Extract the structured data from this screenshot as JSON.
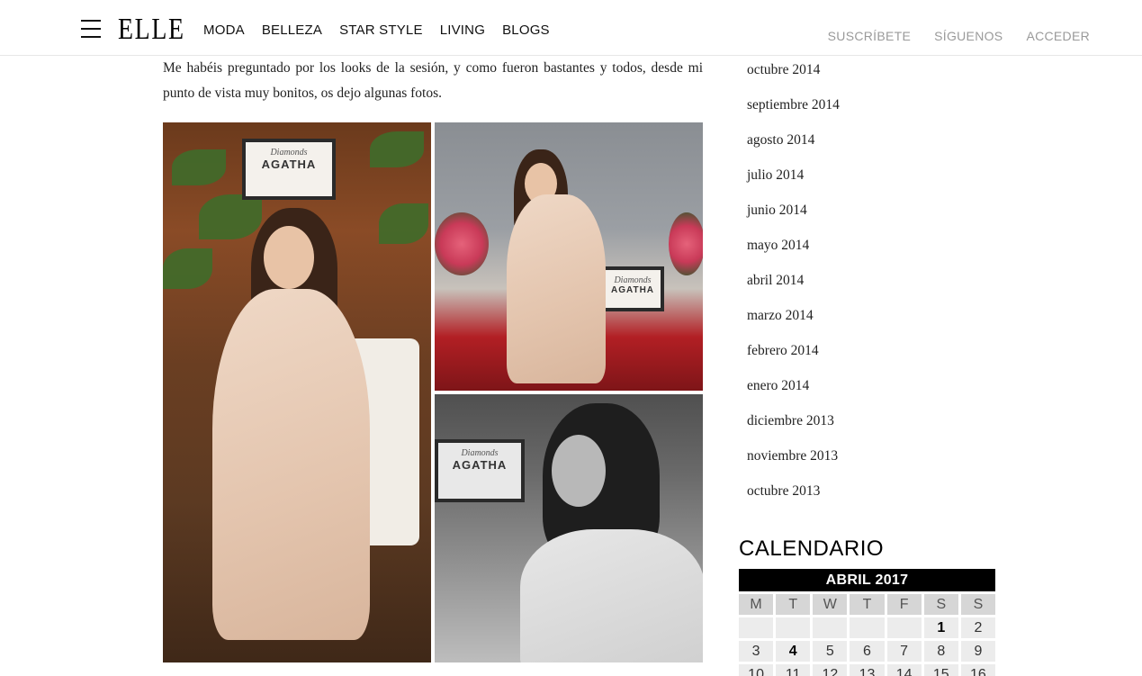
{
  "header": {
    "logo": "ELLE",
    "nav": [
      "MODA",
      "BELLEZA",
      "STAR STYLE",
      "LIVING",
      "BLOGS"
    ],
    "util": [
      "SUSCRÍBETE",
      "SÍGUENOS",
      "ACCEDER"
    ]
  },
  "article": {
    "intro": "Me habéis preguntado por los looks de la sesión, y como fueron bastantes y todos, desde mi punto de vista muy bonitos, os dejo algunas fotos.",
    "sign_brand": "AGATHA",
    "sign_script": "Diamonds"
  },
  "sidebar": {
    "archive": [
      "octubre 2014",
      "septiembre 2014",
      "agosto 2014",
      "julio 2014",
      "junio 2014",
      "mayo 2014",
      "abril 2014",
      "marzo 2014",
      "febrero 2014",
      "enero 2014",
      "diciembre 2013",
      "noviembre 2013",
      "octubre 2013"
    ],
    "calendar": {
      "title": "CALENDARIO",
      "month": "ABRIL 2017",
      "days_of_week": [
        "M",
        "T",
        "W",
        "T",
        "F",
        "S",
        "S"
      ],
      "rows": [
        [
          "",
          "",
          "",
          "",
          "",
          "1",
          "2"
        ],
        [
          "3",
          "4",
          "5",
          "6",
          "7",
          "8",
          "9"
        ],
        [
          "10",
          "11",
          "12",
          "13",
          "14",
          "15",
          "16"
        ]
      ],
      "bold_days": [
        "1",
        "4"
      ]
    }
  }
}
